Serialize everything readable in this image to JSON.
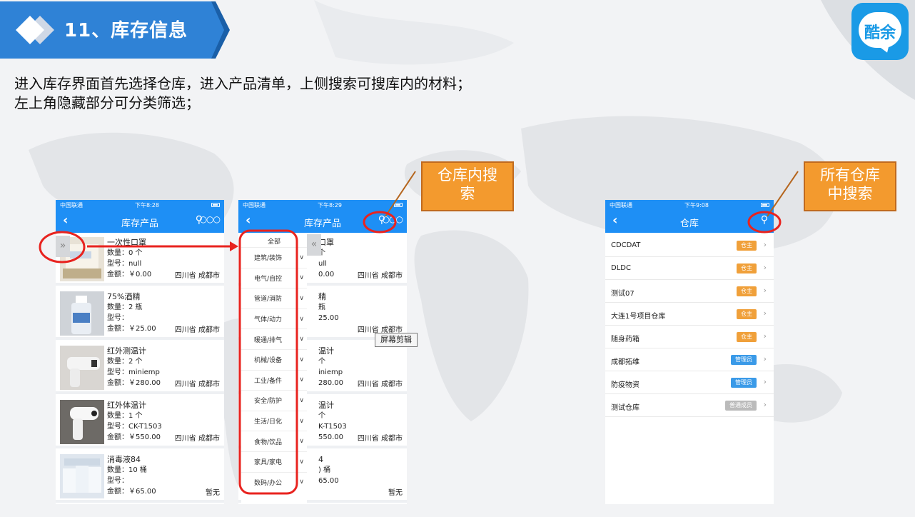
{
  "header": {
    "title": "11、库存信息"
  },
  "logo": {
    "text": "酷余"
  },
  "description": {
    "line1": "进入库存界面首先选择仓库，进入产品清单，上侧搜索可搜库内的材料；",
    "line2": "左上角隐藏部分可分类筛选；"
  },
  "phone1": {
    "carrier": "中国联通",
    "time": "下午8:28",
    "title": "库存产品",
    "items": [
      {
        "name": "一次性口罩",
        "qty": "数量：0 个",
        "model": "型号：null",
        "amount": "金额：￥0.00",
        "loc": "四川省 成都市"
      },
      {
        "name": "75%酒精",
        "qty": "数量：2 瓶",
        "model": "型号：",
        "amount": "金额：￥25.00",
        "loc": "四川省 成都市"
      },
      {
        "name": "红外测温计",
        "qty": "数量：2 个",
        "model": "型号：miniemp",
        "amount": "金额：￥280.00",
        "loc": "四川省 成都市"
      },
      {
        "name": "红外体温计",
        "qty": "数量：1 个",
        "model": "型号：CK-T1503",
        "amount": "金额：￥550.00",
        "loc": "四川省 成都市"
      },
      {
        "name": "消毒液84",
        "qty": "数量：10 桶",
        "model": "型号：",
        "amount": "金额：￥65.00",
        "loc": "暂无"
      }
    ]
  },
  "phone2": {
    "carrier": "中国联通",
    "time": "下午8:29",
    "title": "库存产品",
    "all_label": "全部",
    "categories": [
      "建筑/装饰",
      "电气/自控",
      "管道/消防",
      "气体/动力",
      "暖通/排气",
      "机械/设备",
      "工业/备件",
      "安全/防护",
      "生活/日化",
      "食物/饮品",
      "家具/家电",
      "数码/办公"
    ],
    "partial": [
      {
        "name": "口罩",
        "qty": "个",
        "model": "ull",
        "amount": "0.00",
        "loc": "四川省 成都市"
      },
      {
        "name": "精",
        "qty": "瓶",
        "model": "",
        "amount": "25.00",
        "loc": "四川省 成都市"
      },
      {
        "name": "温计",
        "qty": "个",
        "model": "iniemp",
        "amount": "280.00",
        "loc": "四川省 成都市"
      },
      {
        "name": "温计",
        "qty": "个",
        "model": "K-T1503",
        "amount": "550.00",
        "loc": "四川省 成都市"
      },
      {
        "name": "4",
        "qty": ") 桶",
        "model": "",
        "amount": "65.00",
        "loc": "暂无"
      }
    ],
    "tooltip": "屏幕剪辑"
  },
  "phone3": {
    "carrier": "中国联通",
    "time": "下午9:08",
    "title": "仓库",
    "warehouses": [
      {
        "name": "CDCDAT",
        "tag": "仓主",
        "color": "#f0a03a"
      },
      {
        "name": "DLDC",
        "tag": "仓主",
        "color": "#f0a03a"
      },
      {
        "name": "测试07",
        "tag": "仓主",
        "color": "#f0a03a"
      },
      {
        "name": "大连1号项目仓库",
        "tag": "仓主",
        "color": "#f0a03a"
      },
      {
        "name": "随身药箱",
        "tag": "仓主",
        "color": "#f0a03a"
      },
      {
        "name": "成都拓维",
        "tag": "管理员",
        "color": "#3a9ae8"
      },
      {
        "name": "防疫物资",
        "tag": "管理员",
        "color": "#3a9ae8"
      },
      {
        "name": "测试仓库",
        "tag": "普通成员",
        "color": "#bbbbbb"
      }
    ]
  },
  "callouts": {
    "inner_search": {
      "line1": "仓库内搜",
      "line2": "索"
    },
    "all_search": {
      "line1": "所有仓库",
      "line2": "中搜索"
    }
  },
  "colors": {
    "accent": "#1e8ff5",
    "callout": "#f39a2e",
    "highlight": "#e8231f"
  }
}
